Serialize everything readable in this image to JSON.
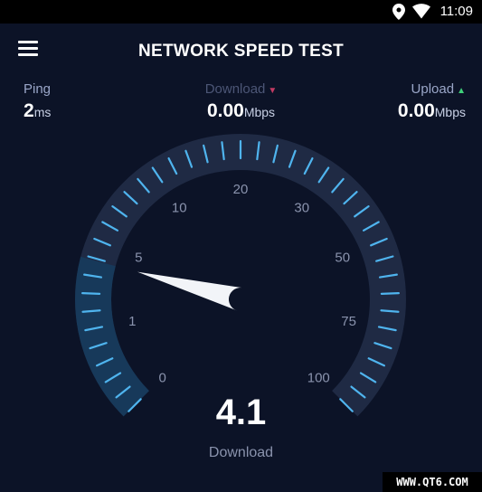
{
  "status_bar": {
    "time": "11:09"
  },
  "header": {
    "title": "NETWORK SPEED TEST"
  },
  "metrics": {
    "ping": {
      "label": "Ping",
      "value": "2",
      "unit": "ms"
    },
    "download": {
      "label": "Download",
      "value": "0.00",
      "unit": "Mbps"
    },
    "upload": {
      "label": "Upload",
      "value": "0.00",
      "unit": "Mbps"
    }
  },
  "gauge": {
    "scale_labels": [
      "0",
      "1",
      "5",
      "10",
      "20",
      "30",
      "50",
      "75",
      "100"
    ],
    "current_value": 4.1
  },
  "reading": {
    "value": "4.1",
    "label": "Download"
  },
  "watermark": "WWW.QT6.COM",
  "colors": {
    "background": "#0c1327",
    "track": "#1f2a44",
    "fill": "#17395a",
    "tick": "#4fb4ee"
  }
}
